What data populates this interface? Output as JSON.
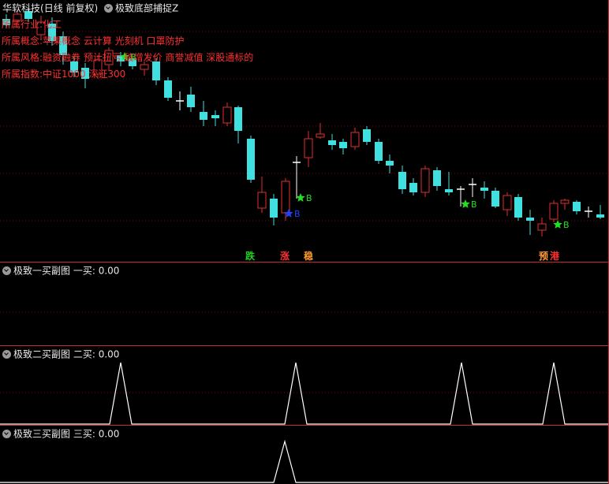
{
  "main": {
    "stock_name": "华软科技",
    "period": "(日线 前复权)",
    "indicator": "极致底部捕捉Z",
    "info_lines": [
      "所属行业:化工",
      "所属概念:苹果概念 云计算 光刻机 口罩防护",
      "所属风格:融资融券 预计扭亏 破增发价 商誉减值 深股通标的",
      "所属指数:中证1000 深证300"
    ],
    "signals": [
      {
        "text": "跌",
        "color": "#20d020"
      },
      {
        "text": "涨",
        "color": "#ff3030"
      },
      {
        "text": "稳",
        "color": "#ff9a30"
      },
      {
        "text": "预",
        "color": "#ff9a30"
      },
      {
        "text": "港",
        "color": "#ff3030"
      }
    ],
    "buy_mark": "B",
    "colors": {
      "up": "#e03030",
      "down": "#40e0e0",
      "doji": "#ffffff",
      "star_green": "#20e020",
      "star_blue": "#2040ff",
      "grid": "#800000"
    }
  },
  "sub1": {
    "title": "极致一买副图",
    "label": "一买:",
    "value": "0.00"
  },
  "sub2": {
    "title": "极致二买副图",
    "label": "二买:",
    "value": "0.00"
  },
  "sub3": {
    "title": "极致三买副图",
    "label": "三买:",
    "value": "0.00"
  }
}
